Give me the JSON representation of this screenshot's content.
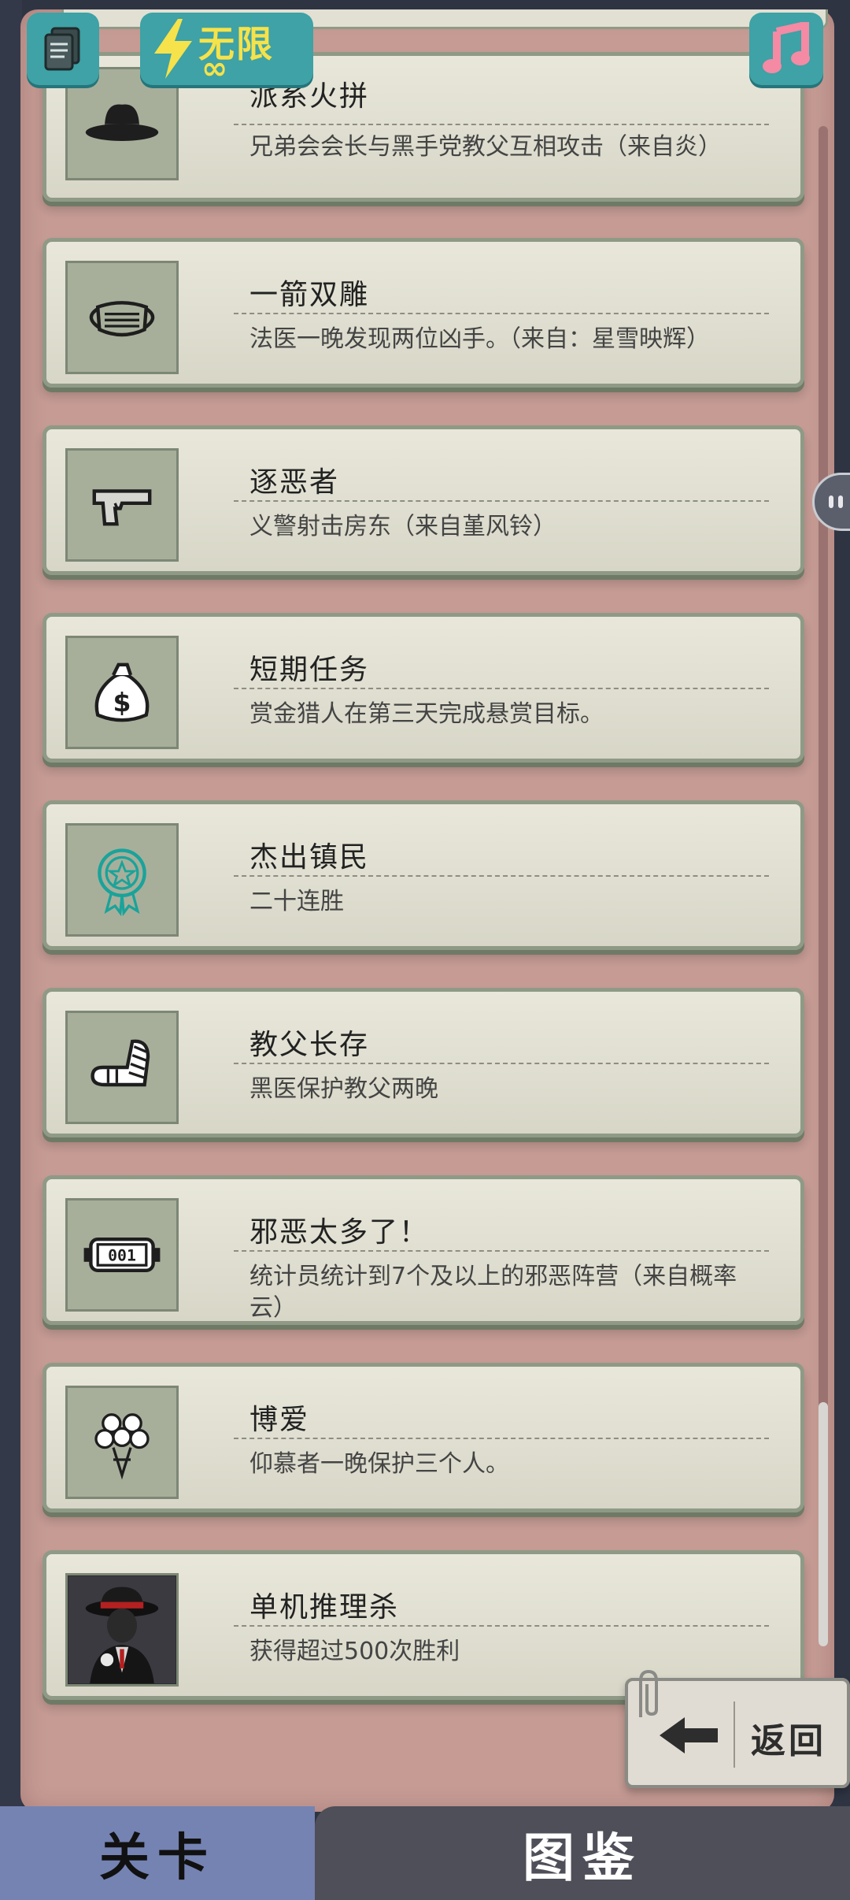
{
  "topbar": {
    "energy_label": "无限",
    "energy_value": "∞"
  },
  "achievements": [
    {
      "title": "派系火拼",
      "desc": "兄弟会会长与黑手党教父互相攻击（来自炎）",
      "icon": "hat-icon"
    },
    {
      "title": "一箭双雕",
      "desc": "法医一晚发现两位凶手。（来自：星雪映辉）",
      "icon": "mask-icon"
    },
    {
      "title": "逐恶者",
      "desc": "义警射击房东（来自堇风铃）",
      "icon": "pistol-icon"
    },
    {
      "title": "短期任务",
      "desc": "赏金猎人在第三天完成悬赏目标。",
      "icon": "money-bag-icon"
    },
    {
      "title": "杰出镇民",
      "desc": "二十连胜",
      "icon": "medal-icon"
    },
    {
      "title": "教父长存",
      "desc": "黑医保护教父两晚",
      "icon": "bandaged-arm-icon"
    },
    {
      "title": "邪恶太多了！",
      "desc": "统计员统计到7个及以上的邪恶阵营（来自概率云）",
      "icon": "counter-icon",
      "counter_text": "001"
    },
    {
      "title": "博爱",
      "desc": "仰慕者一晚保护三个人。",
      "icon": "bouquet-icon"
    },
    {
      "title": "单机推理杀",
      "desc": "获得超过500次胜利",
      "icon": "godfather-portrait-icon"
    }
  ],
  "back_button": {
    "label": "返回"
  },
  "tabs": {
    "left": "关卡",
    "right": "图鉴"
  },
  "colors": {
    "panel": "#c59b94",
    "card": "#e2e0d2",
    "accent": "#3ea2a6",
    "energy": "#f6e24a"
  }
}
